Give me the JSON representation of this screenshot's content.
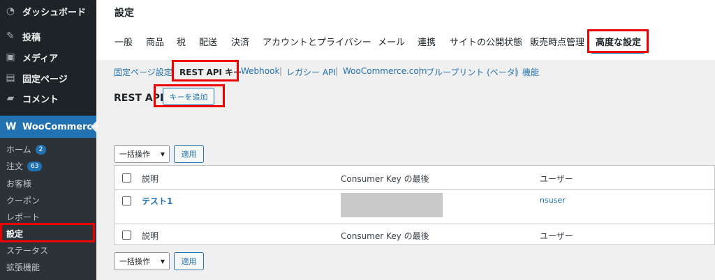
{
  "sidebar": {
    "items": [
      {
        "label": "ダッシュボード",
        "icon": "dashboard-icon"
      },
      {
        "label": "投稿",
        "icon": "pin-icon"
      },
      {
        "label": "メディア",
        "icon": "media-icon"
      },
      {
        "label": "固定ページ",
        "icon": "page-icon"
      },
      {
        "label": "コメント",
        "icon": "comment-icon"
      }
    ],
    "woocommerce": {
      "label": "WooCommerce",
      "icon": "woo-icon"
    },
    "submenu": [
      {
        "label": "ホーム",
        "badge": "2"
      },
      {
        "label": "注文",
        "badge": "63"
      },
      {
        "label": "お客様"
      },
      {
        "label": "クーポン"
      },
      {
        "label": "レポート"
      },
      {
        "label": "設定"
      },
      {
        "label": "ステータス"
      },
      {
        "label": "拡張機能"
      }
    ]
  },
  "page": {
    "title": "設定",
    "tabs": [
      "一般",
      "商品",
      "税",
      "配送",
      "決済",
      "アカウントとプライバシー",
      "メール",
      "連携",
      "サイトの公開状態",
      "販売時点管理",
      "高度な設定"
    ],
    "sections": [
      "固定ページ設定",
      "REST API キー",
      "Webhook",
      "レガシー API",
      "WooCommerce.com",
      "ブループリント (ベータ)",
      "機能"
    ],
    "heading": "REST API",
    "add_key": "キーを追加",
    "bulk_action": "一括操作",
    "apply": "適用"
  },
  "table": {
    "columns": [
      "説明",
      "Consumer Key の最後",
      "ユーザー"
    ],
    "rows": [
      {
        "description": "テスト1",
        "user": "nsuser"
      }
    ]
  },
  "colors": {
    "accent": "#2271b1",
    "highlight": "#e00000",
    "sidebar": "#1d2327"
  }
}
